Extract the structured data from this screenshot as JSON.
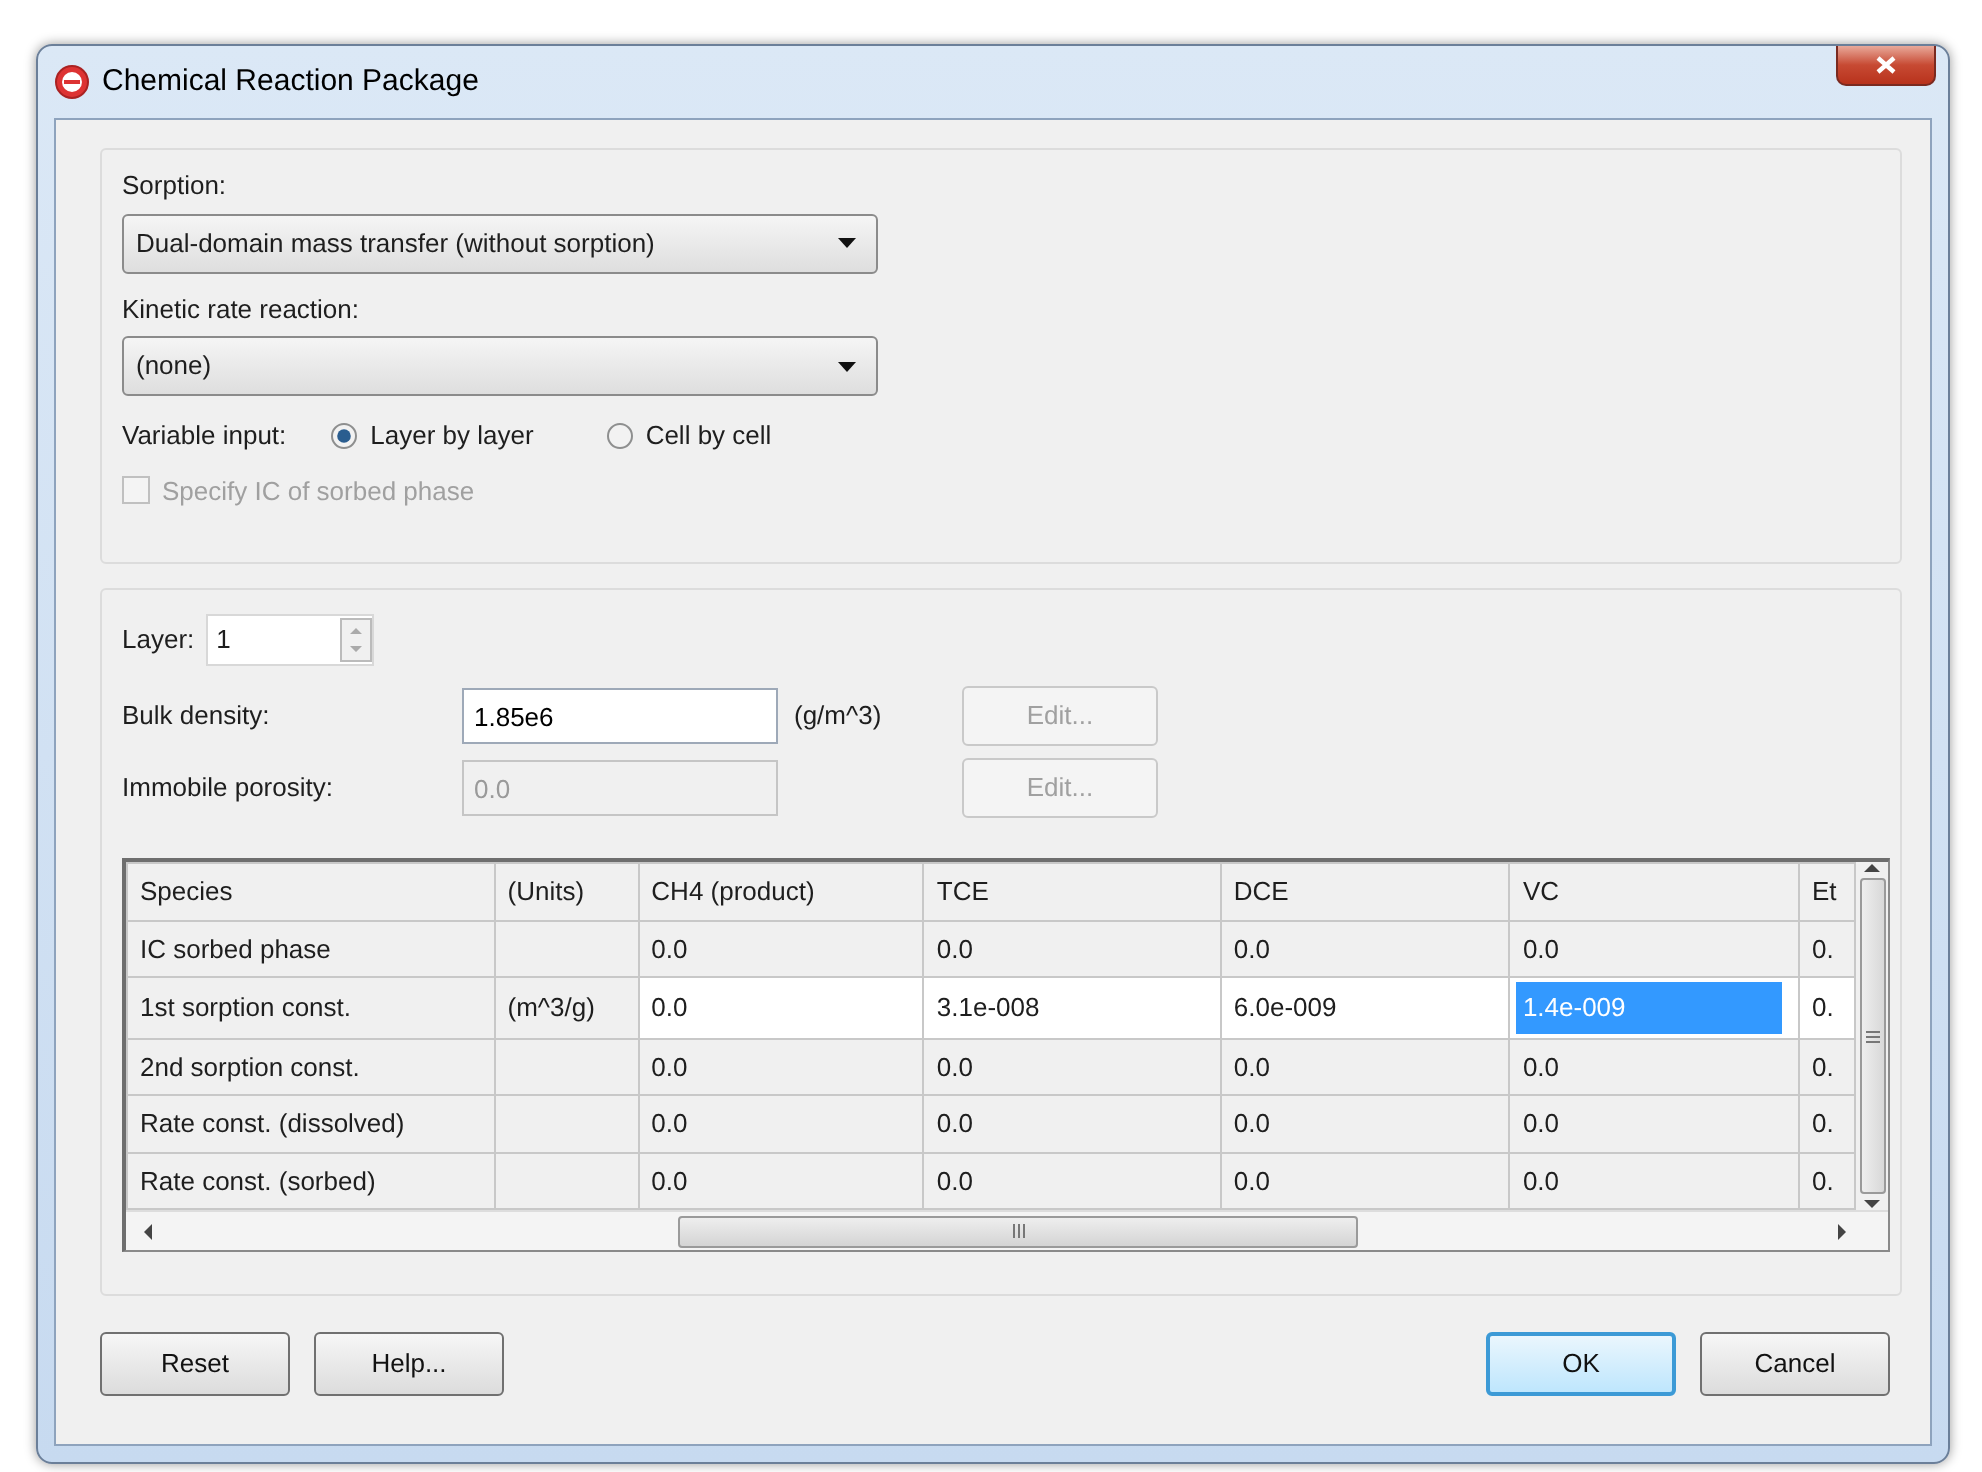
{
  "window": {
    "title": "Chemical Reaction Package"
  },
  "sorption": {
    "label": "Sorption:",
    "value": "Dual-domain mass transfer (without sorption)"
  },
  "kinetic": {
    "label": "Kinetic rate reaction:",
    "value": "(none)"
  },
  "variable_input": {
    "label": "Variable input:",
    "options": [
      {
        "label": "Layer by layer",
        "selected": true
      },
      {
        "label": "Cell by cell",
        "selected": false
      }
    ]
  },
  "specify_ic": {
    "label": "Specify IC of sorbed phase",
    "checked": false,
    "disabled": true
  },
  "layer": {
    "label": "Layer:",
    "value": "1"
  },
  "fields": [
    {
      "label": "Bulk density:",
      "value": "1.85e6",
      "units": "(g/m^3)",
      "disabled": false,
      "button": "Edit..."
    },
    {
      "label": "Immobile porosity:",
      "value": "0.0",
      "disabled": true,
      "button": "Edit..."
    }
  ],
  "table": {
    "columns": [
      "Species",
      "(Units)",
      "CH4 (product)",
      "TCE",
      "DCE",
      "VC",
      "Et"
    ],
    "rows": [
      {
        "current": false,
        "cells": [
          {
            "text": "IC sorbed phase",
            "selected": false
          },
          {
            "text": "",
            "selected": false
          },
          {
            "text": "0.0",
            "selected": false
          },
          {
            "text": "0.0",
            "selected": false
          },
          {
            "text": "0.0",
            "selected": false
          },
          {
            "text": "0.0",
            "selected": false
          },
          {
            "text": "0.",
            "selected": false
          }
        ]
      },
      {
        "current": true,
        "cells": [
          {
            "text": "1st sorption const.",
            "selected": false
          },
          {
            "text": "(m^3/g)",
            "selected": false
          },
          {
            "text": "0.0",
            "selected": false
          },
          {
            "text": "3.1e-008",
            "selected": false
          },
          {
            "text": "6.0e-009",
            "selected": false
          },
          {
            "text": "1.4e-009",
            "selected": true
          },
          {
            "text": "0.",
            "selected": false
          }
        ]
      },
      {
        "current": false,
        "cells": [
          {
            "text": "2nd sorption const.",
            "selected": false
          },
          {
            "text": "",
            "selected": false
          },
          {
            "text": "0.0",
            "selected": false
          },
          {
            "text": "0.0",
            "selected": false
          },
          {
            "text": "0.0",
            "selected": false
          },
          {
            "text": "0.0",
            "selected": false
          },
          {
            "text": "0.",
            "selected": false
          }
        ]
      },
      {
        "current": false,
        "cells": [
          {
            "text": "Rate const. (dissolved)",
            "selected": false
          },
          {
            "text": "",
            "selected": false
          },
          {
            "text": "0.0",
            "selected": false
          },
          {
            "text": "0.0",
            "selected": false
          },
          {
            "text": "0.0",
            "selected": false
          },
          {
            "text": "0.0",
            "selected": false
          },
          {
            "text": "0.",
            "selected": false
          }
        ]
      },
      {
        "current": false,
        "cells": [
          {
            "text": "Rate const. (sorbed)",
            "selected": false
          },
          {
            "text": "",
            "selected": false
          },
          {
            "text": "0.0",
            "selected": false
          },
          {
            "text": "0.0",
            "selected": false
          },
          {
            "text": "0.0",
            "selected": false
          },
          {
            "text": "0.0",
            "selected": false
          },
          {
            "text": "0.",
            "selected": false
          }
        ]
      }
    ]
  },
  "buttons": {
    "left": [
      {
        "label": "Reset",
        "default": false
      },
      {
        "label": "Help...",
        "default": false
      }
    ],
    "right": [
      {
        "label": "OK",
        "default": true
      },
      {
        "label": "Cancel",
        "default": false
      }
    ]
  }
}
